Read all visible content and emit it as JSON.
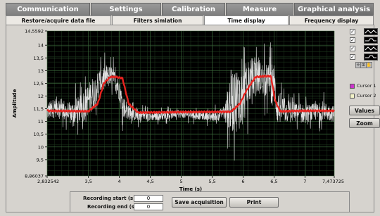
{
  "top_tabs": [
    {
      "label": "Communication"
    },
    {
      "label": "Settings"
    },
    {
      "label": "Calibration"
    },
    {
      "label": "Measure"
    },
    {
      "label": "Graphical analysis"
    }
  ],
  "sub_tabs": [
    {
      "label": "Restore/acquire data file"
    },
    {
      "label": "Filters simlation"
    },
    {
      "label": "Time display"
    },
    {
      "label": "Frequency display"
    }
  ],
  "legend_checkboxes": [
    {
      "checked": "✓"
    },
    {
      "checked": "✓"
    },
    {
      "checked": "✓"
    },
    {
      "checked": "✓"
    }
  ],
  "cursors": [
    {
      "label": "Cursor 1",
      "color": "#cc33cc"
    },
    {
      "label": "Cursor 2",
      "color": "#f2f2c8"
    }
  ],
  "buttons": {
    "values": "Values",
    "zoom": "Zoom",
    "save": "Save acquisition",
    "print": "Print"
  },
  "recording": {
    "start_label": "Recording start (s)",
    "start_value": "0",
    "end_label": "Recording end (s)",
    "end_value": "0"
  },
  "chart_data": {
    "type": "line",
    "xlabel": "Time (s)",
    "ylabel": "Amplitude",
    "xlim": [
      2.832542,
      7.473725
    ],
    "ylim": [
      8.86037,
      14.5592
    ],
    "x_ticks": [
      "2,832542",
      "3,5",
      "4",
      "4,5",
      "5",
      "5,5",
      "6",
      "6,5",
      "7",
      "7,473725"
    ],
    "x_tick_values": [
      2.832542,
      3.5,
      4,
      4.5,
      5,
      5.5,
      6,
      6.5,
      7,
      7.473725
    ],
    "y_ticks": [
      "8,86037",
      "9,5",
      "10",
      "10,5",
      "11",
      "11,5",
      "12",
      "12,5",
      "13",
      "13,5",
      "14",
      "14,5592"
    ],
    "y_tick_values": [
      8.86037,
      9.5,
      10,
      10.5,
      11,
      11.5,
      12,
      12.5,
      13,
      13.5,
      14,
      14.5592
    ],
    "grid": true,
    "background": "#000000",
    "series": [
      {
        "color": "#f2f2f2",
        "description": "raw noisy signal",
        "x": [
          2.84,
          3.0,
          3.2,
          3.4,
          3.5,
          3.6,
          3.7,
          3.8,
          3.9,
          4.0,
          4.05,
          4.2,
          4.5,
          5.0,
          5.5,
          5.7,
          5.8,
          5.9,
          6.0,
          6.1,
          6.2,
          6.3,
          6.4,
          6.5,
          6.55,
          6.7,
          7.0,
          7.3,
          7.47
        ],
        "y": [
          11.4,
          11.6,
          11.3,
          11.5,
          11.9,
          12.2,
          12.6,
          12.8,
          12.7,
          12.3,
          11.6,
          11.3,
          11.2,
          11.3,
          11.2,
          11.3,
          11.8,
          11.9,
          12.0,
          12.6,
          12.8,
          12.7,
          12.6,
          12.4,
          11.6,
          11.4,
          11.3,
          11.4,
          11.3
        ],
        "envelope": [
          0.8,
          0.9,
          1.0,
          1.3,
          1.4,
          1.5,
          1.2,
          1.0,
          0.9,
          1.1,
          1.0,
          0.6,
          0.4,
          0.35,
          0.4,
          0.6,
          2.8,
          2.9,
          2.6,
          2.0,
          1.6,
          1.4,
          1.5,
          2.0,
          1.6,
          1.0,
          0.8,
          0.8,
          0.7
        ]
      },
      {
        "color": "#e8231f",
        "description": "filtered signal",
        "x": [
          2.84,
          3.5,
          3.65,
          3.75,
          3.85,
          3.95,
          4.05,
          4.15,
          4.3,
          5.0,
          5.8,
          5.95,
          6.05,
          6.2,
          6.35,
          6.45,
          6.52,
          6.6,
          7.0,
          7.47
        ],
        "y": [
          11.42,
          11.4,
          11.7,
          12.5,
          12.75,
          12.75,
          12.7,
          11.7,
          11.35,
          11.37,
          11.38,
          11.7,
          12.2,
          12.75,
          12.78,
          12.78,
          11.8,
          11.4,
          11.42,
          11.42
        ]
      }
    ]
  }
}
